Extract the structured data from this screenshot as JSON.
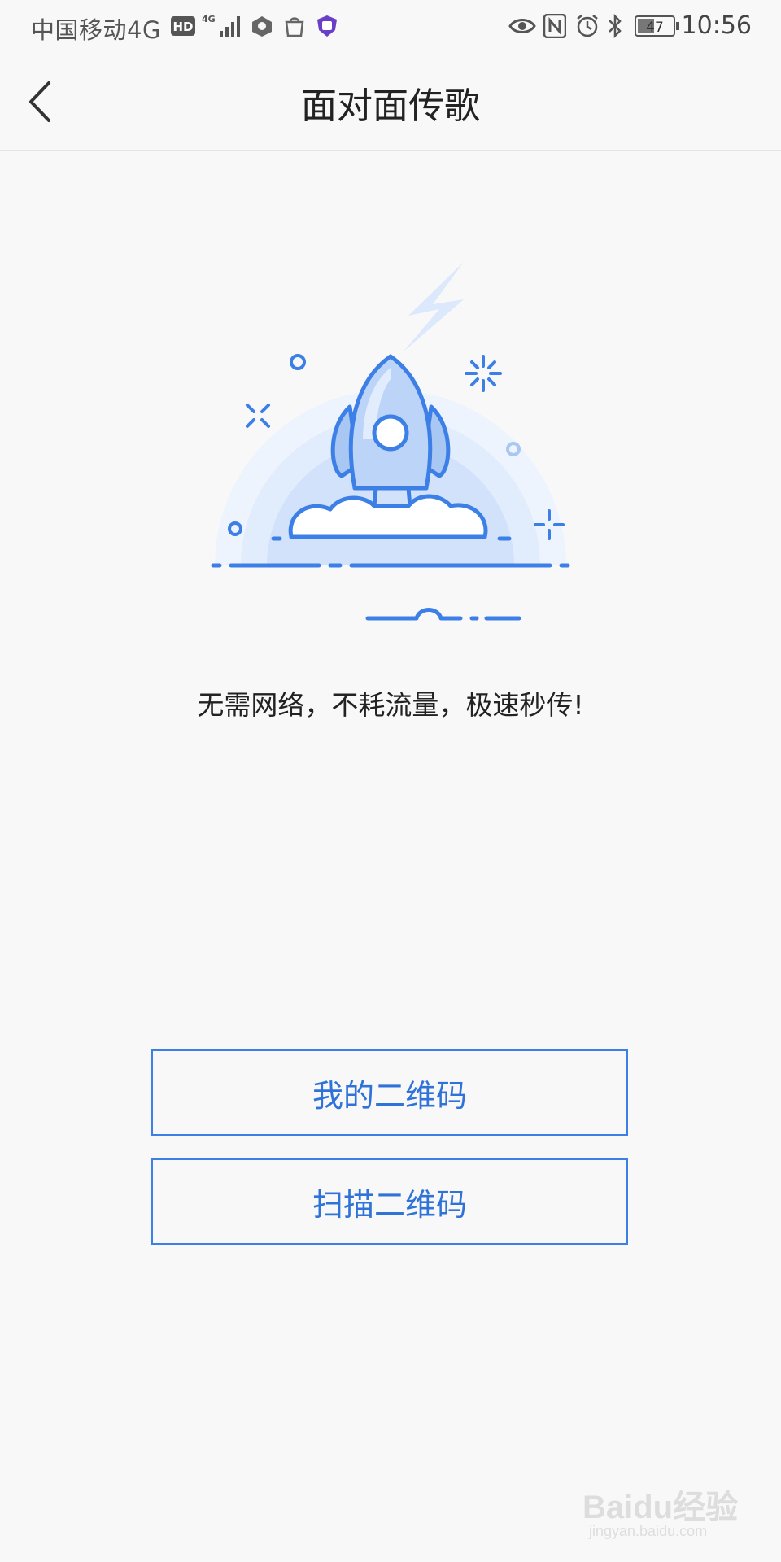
{
  "status_bar": {
    "carrier": "中国移动4G",
    "hd_label": "HD",
    "network_label": "4G",
    "battery": "47",
    "time": "10:56",
    "icons": [
      "hd-icon",
      "signal-icon",
      "app-icon",
      "bag-icon",
      "tie-icon",
      "eye-icon",
      "nfc-icon",
      "alarm-icon",
      "bluetooth-icon",
      "battery-icon"
    ]
  },
  "nav": {
    "title": "面对面传歌",
    "back_icon": "chevron-left-icon"
  },
  "hero": {
    "illustration": "rocket-icon",
    "accent": "#3c7fe6",
    "light": "#cfe0fb"
  },
  "tagline": "无需网络，不耗流量，极速秒传!",
  "buttons": {
    "my_qr": "我的二维码",
    "scan_qr": "扫描二维码"
  },
  "watermark": {
    "text": "Baidu经验",
    "sub": "jingyan.baidu.com"
  }
}
